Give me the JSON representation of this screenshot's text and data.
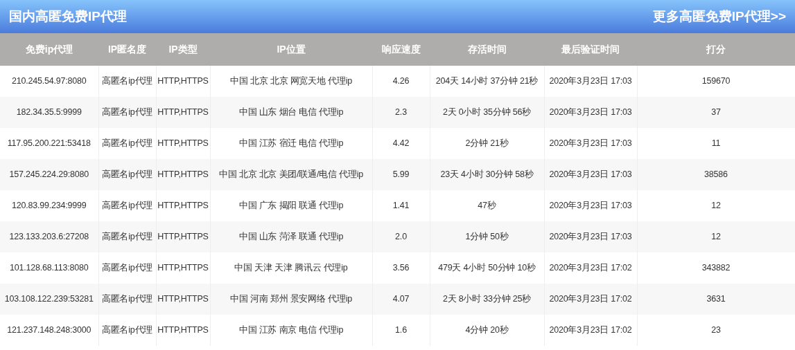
{
  "title": "国内高匿免费IP代理",
  "more_link": "更多高匿免费IP代理>>",
  "table": {
    "columns": [
      "免费ip代理",
      "IP匿名度",
      "IP类型",
      "IP位置",
      "响应速度",
      "存活时间",
      "最后验证时间",
      "打分"
    ],
    "rows": [
      {
        "cells": [
          "210.245.54.97:8080",
          "高匿名ip代理",
          "HTTP,HTTPS",
          "中国 北京 北京 网宽天地 代理ip",
          "4.26",
          "204天 14小时 37分钟 21秒",
          "2020年3月23日 17:03",
          "159670"
        ]
      },
      {
        "cells": [
          "182.34.35.5:9999",
          "高匿名ip代理",
          "HTTP,HTTPS",
          "中国 山东 烟台 电信 代理ip",
          "2.3",
          "2天 0小时 35分钟 56秒",
          "2020年3月23日 17:03",
          "37"
        ]
      },
      {
        "cells": [
          "117.95.200.221:53418",
          "高匿名ip代理",
          "HTTP,HTTPS",
          "中国 江苏 宿迁 电信 代理ip",
          "4.42",
          "2分钟 21秒",
          "2020年3月23日 17:03",
          "11"
        ]
      },
      {
        "cells": [
          "157.245.224.29:8080",
          "高匿名ip代理",
          "HTTP,HTTPS",
          "中国 北京 北京 美团/联通/电信 代理ip",
          "5.99",
          "23天 4小时 30分钟 58秒",
          "2020年3月23日 17:03",
          "38586"
        ]
      },
      {
        "cells": [
          "120.83.99.234:9999",
          "高匿名ip代理",
          "HTTP,HTTPS",
          "中国 广东 揭阳 联通 代理ip",
          "1.41",
          "47秒",
          "2020年3月23日 17:03",
          "12"
        ]
      },
      {
        "cells": [
          "123.133.203.6:27208",
          "高匿名ip代理",
          "HTTP,HTTPS",
          "中国 山东 菏泽 联通 代理ip",
          "2.0",
          "1分钟 50秒",
          "2020年3月23日 17:03",
          "12"
        ]
      },
      {
        "cells": [
          "101.128.68.113:8080",
          "高匿名ip代理",
          "HTTP,HTTPS",
          "中国 天津 天津 腾讯云 代理ip",
          "3.56",
          "479天 4小时 50分钟 10秒",
          "2020年3月23日 17:02",
          "343882"
        ]
      },
      {
        "cells": [
          "103.108.122.239:53281",
          "高匿名ip代理",
          "HTTP,HTTPS",
          "中国 河南 郑州 景安网络 代理ip",
          "4.07",
          "2天 8小时 33分钟 25秒",
          "2020年3月23日 17:02",
          "3631"
        ]
      },
      {
        "cells": [
          "121.237.148.248:3000",
          "高匿名ip代理",
          "HTTP,HTTPS",
          "中国 江苏 南京 电信 代理ip",
          "1.6",
          "4分钟 20秒",
          "2020年3月23日 17:02",
          "23"
        ]
      }
    ]
  }
}
